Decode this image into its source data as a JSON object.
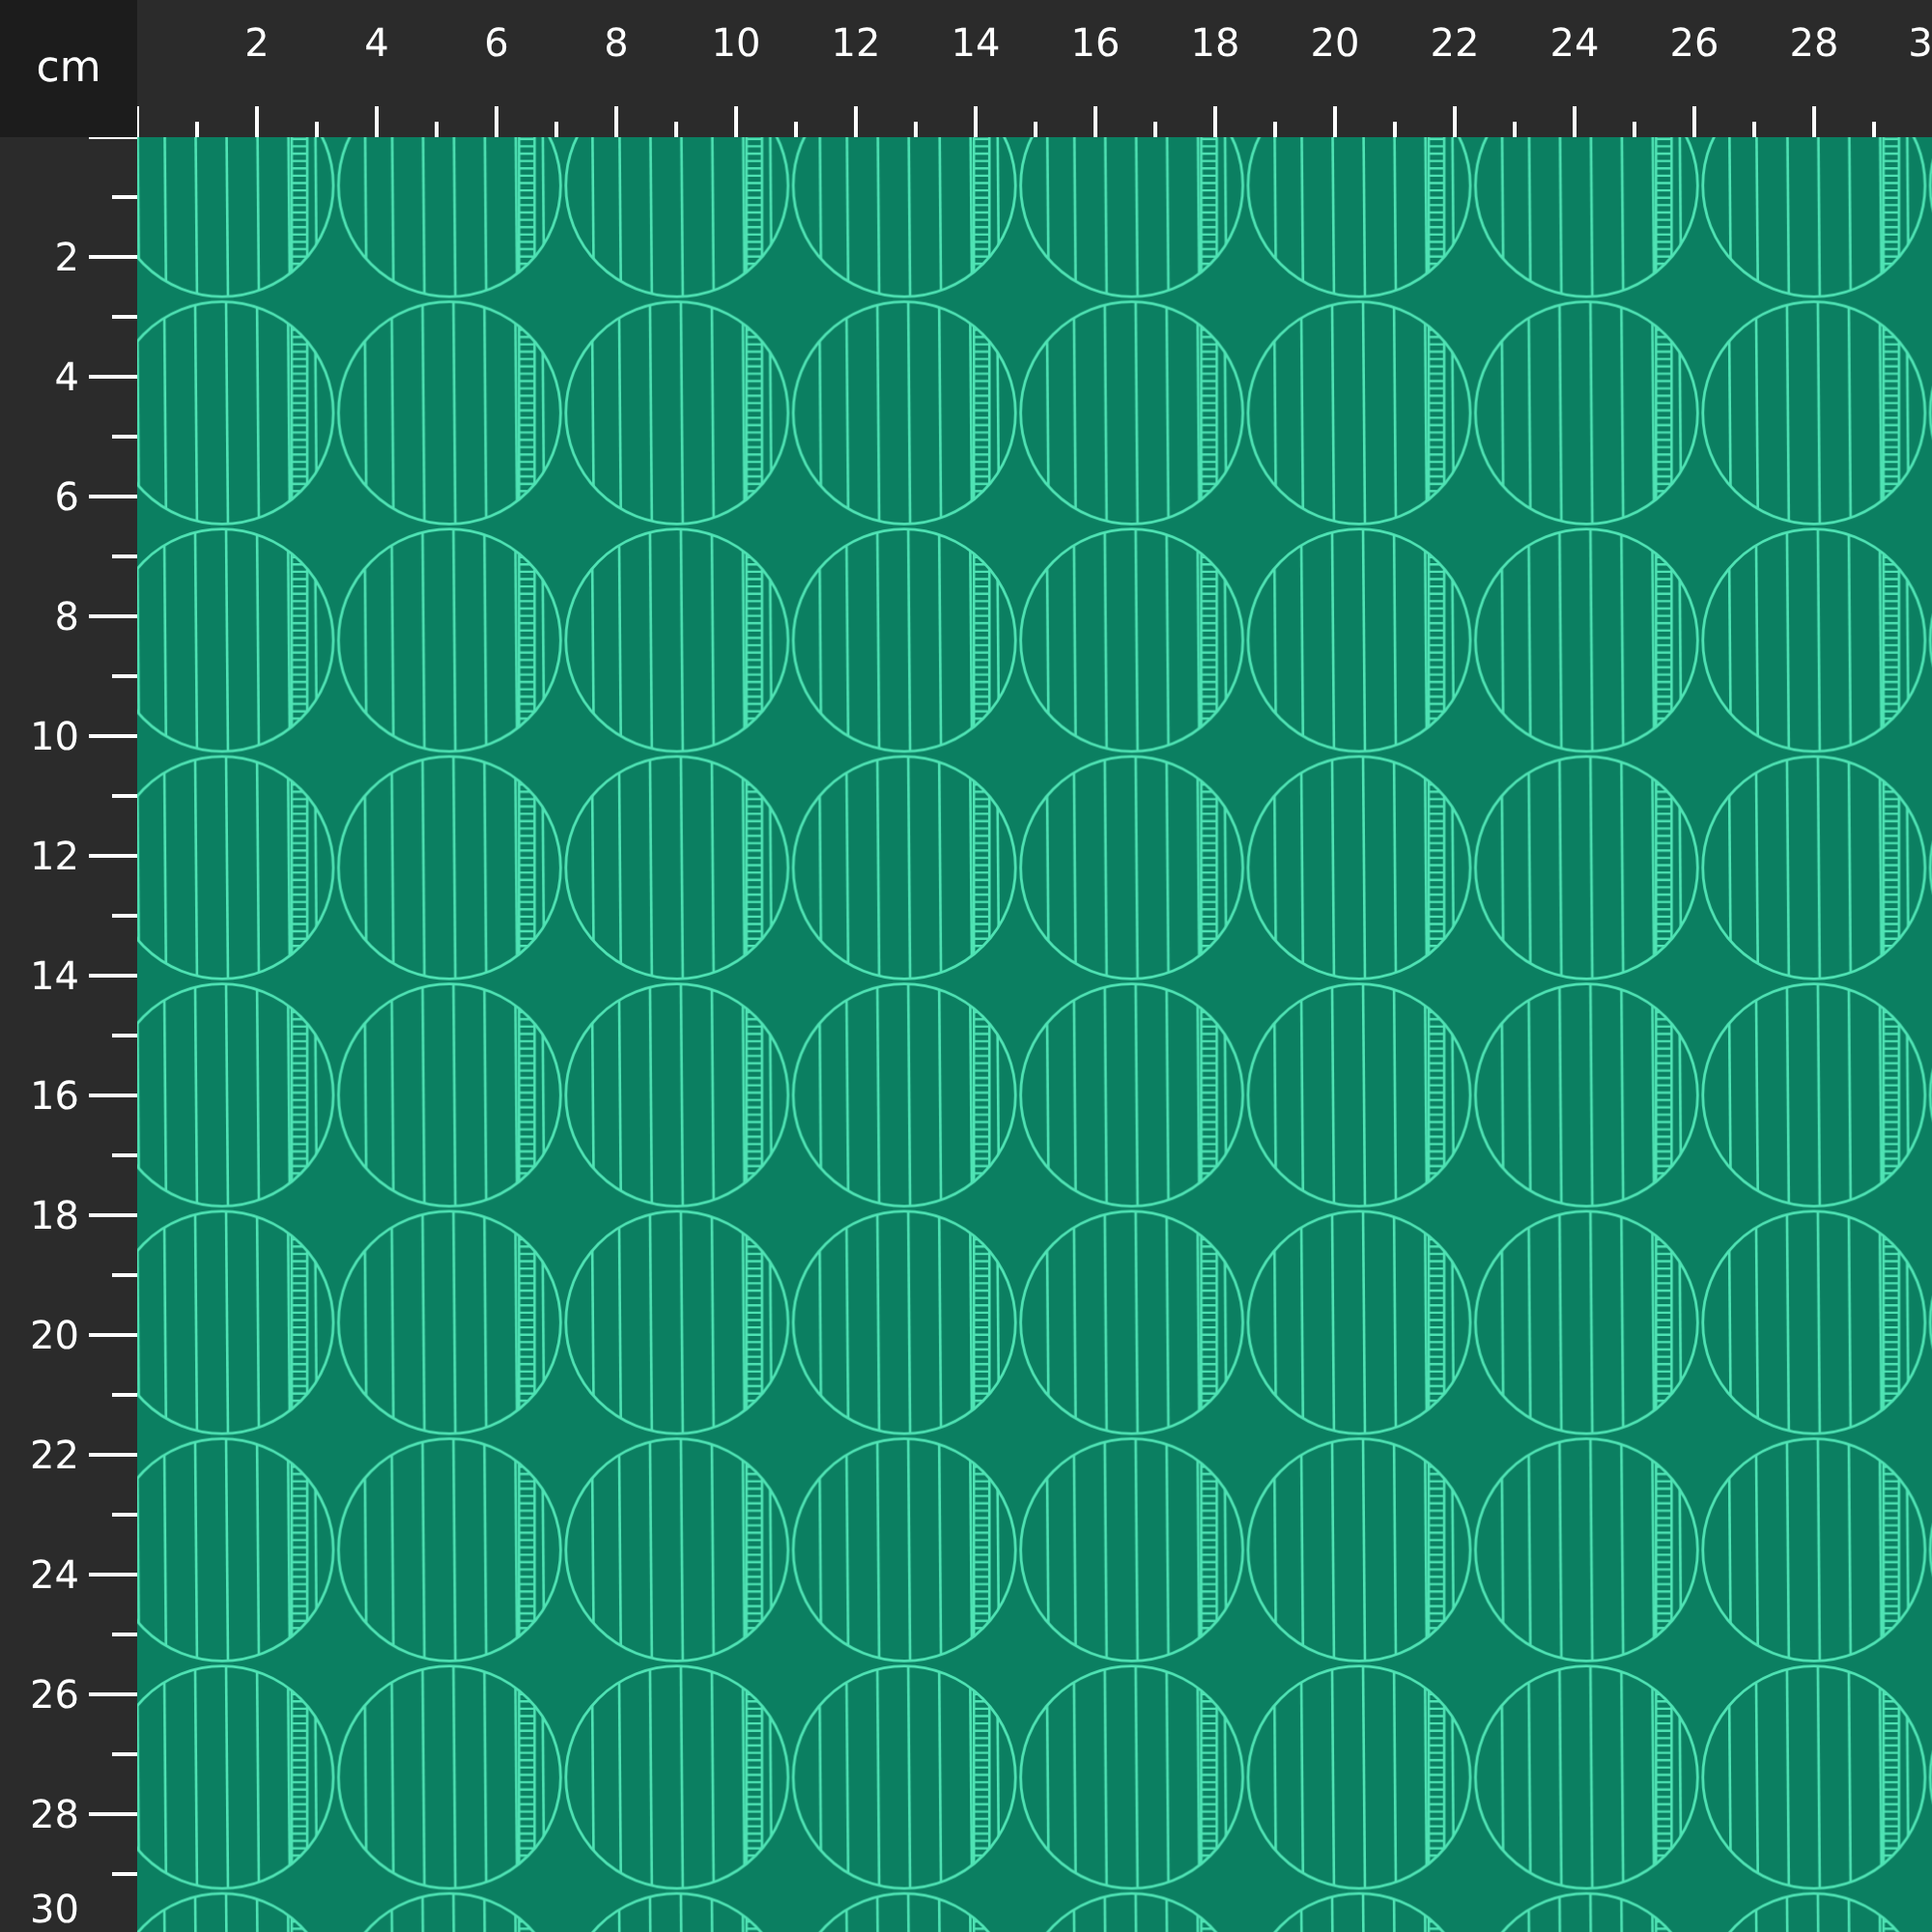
{
  "ruler": {
    "unit": "cm",
    "top_labels": [
      "2",
      "4",
      "6",
      "8",
      "10",
      "12",
      "14",
      "16",
      "18",
      "20",
      "22",
      "24",
      "26",
      "28",
      "3"
    ],
    "left_labels": [
      "2",
      "4",
      "6",
      "8",
      "10",
      "12",
      "14",
      "16",
      "18",
      "20",
      "22",
      "24",
      "26",
      "28",
      "30"
    ]
  }
}
